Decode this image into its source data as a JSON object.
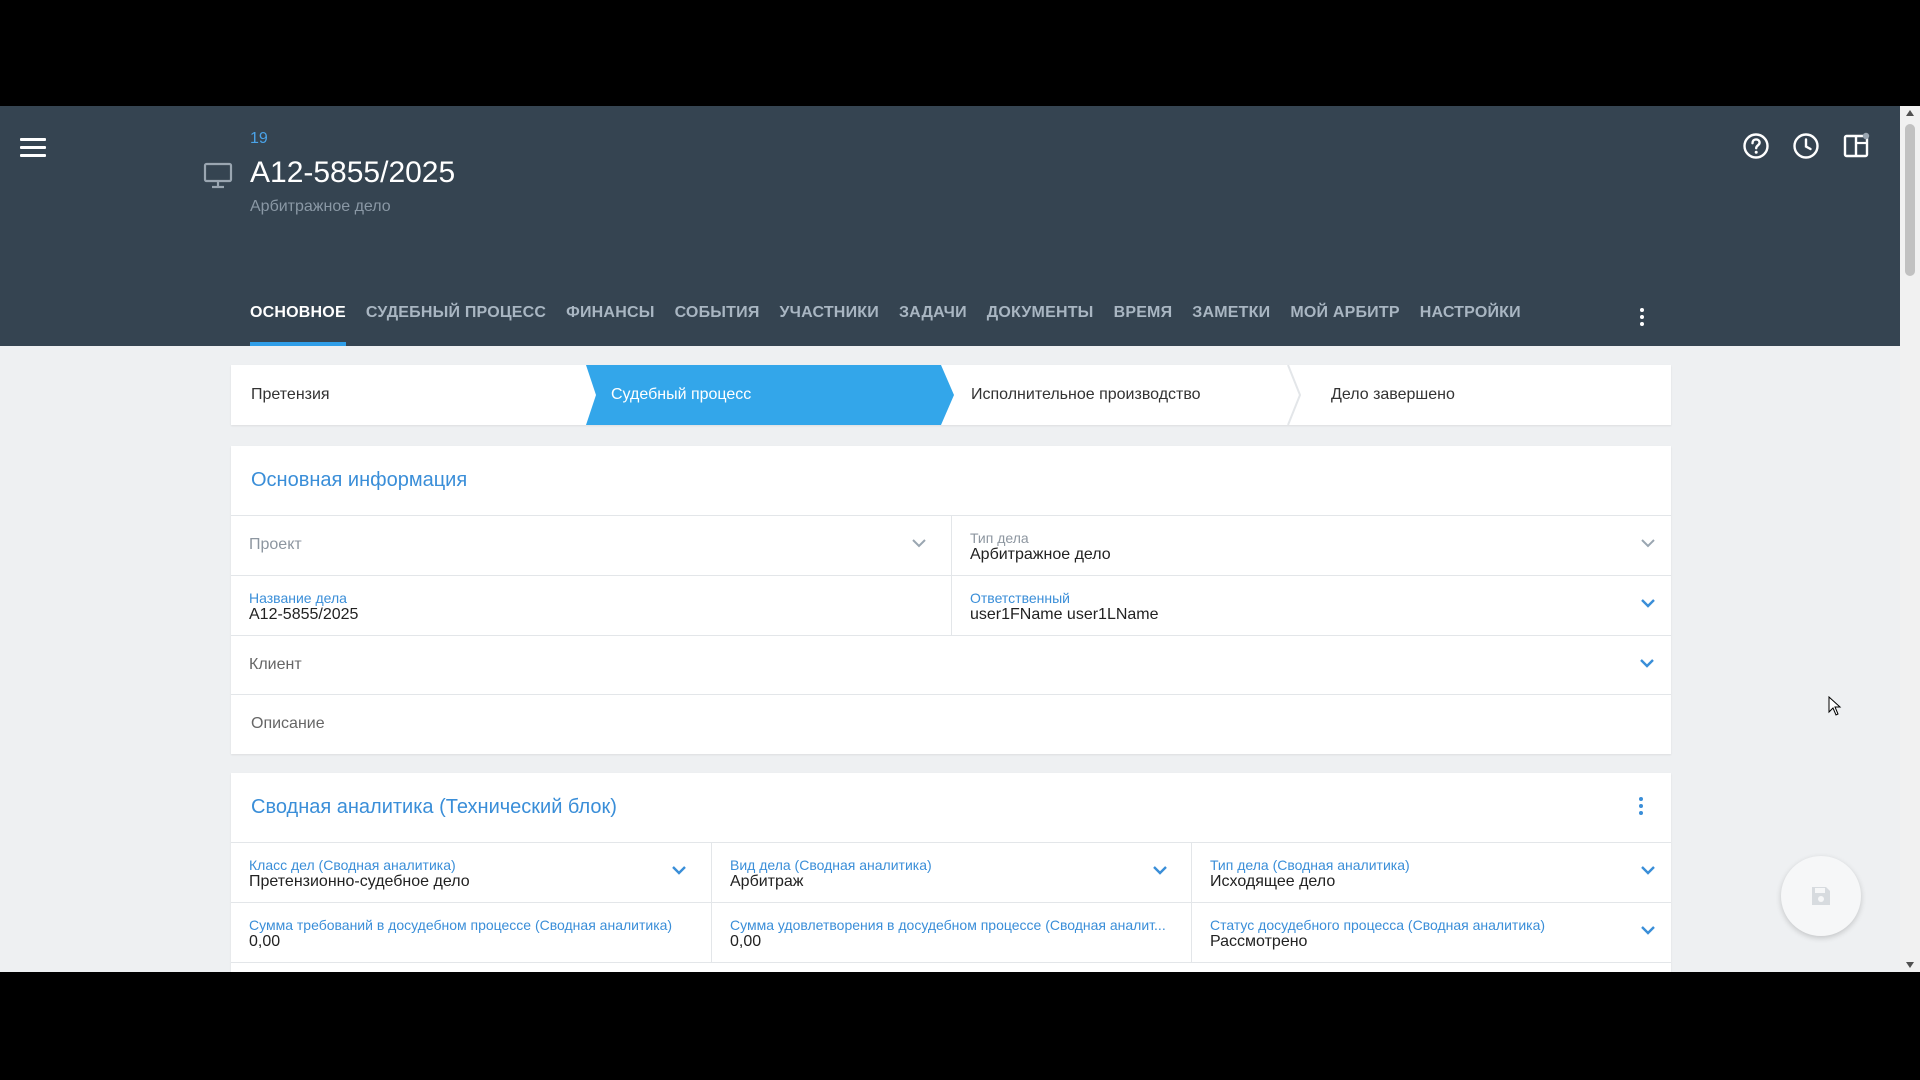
{
  "header": {
    "case_number": "19",
    "title": "А12-5855/2025",
    "subtitle": "Арбитражное дело",
    "icons": [
      "menu-icon",
      "monitor-icon",
      "help-icon",
      "history-clock-icon",
      "panel-layout-icon",
      "more-vertical-icon"
    ]
  },
  "tabs": [
    {
      "label": "ОСНОВНОЕ",
      "active": true
    },
    {
      "label": "СУДЕБНЫЙ ПРОЦЕСС"
    },
    {
      "label": "ФИНАНСЫ"
    },
    {
      "label": "СОБЫТИЯ"
    },
    {
      "label": "УЧАСТНИКИ"
    },
    {
      "label": "ЗАДАЧИ"
    },
    {
      "label": "ДОКУМЕНТЫ"
    },
    {
      "label": "ВРЕМЯ"
    },
    {
      "label": "ЗАМЕТКИ"
    },
    {
      "label": "МОЙ АРБИТР"
    },
    {
      "label": "НАСТРОЙКИ"
    }
  ],
  "stages": [
    {
      "label": "Претензия"
    },
    {
      "label": "Судебный процесс",
      "active": true
    },
    {
      "label": "Исполнительное производство"
    },
    {
      "label": "Дело завершено"
    }
  ],
  "main_info": {
    "title": "Основная информация",
    "project_placeholder": "Проект",
    "case_type": {
      "label": "Тип дела",
      "value": "Арбитражное дело"
    },
    "case_name": {
      "label": "Название дела",
      "value": "А12-5855/2025"
    },
    "responsible": {
      "label": "Ответственный",
      "value": "user1FName user1LName"
    },
    "client_placeholder": "Клиент",
    "description_placeholder": "Описание"
  },
  "analytics": {
    "title": "Сводная аналитика (Технический блок)",
    "fields": [
      {
        "label": "Класс дел (Сводная аналитика)",
        "value": "Претензионно-судебное дело"
      },
      {
        "label": "Вид дела (Сводная аналитика)",
        "value": "Арбитраж"
      },
      {
        "label": "Тип дела (Сводная аналитика)",
        "value": "Исходящее дело"
      },
      {
        "label": "Сумма требований в досудебном процессе (Сводная аналитика)",
        "value": "0,00"
      },
      {
        "label": "Сумма удовлетворения в досудебном процессе (Сводная аналит...",
        "value": "0,00"
      },
      {
        "label": "Статус досудебного процесса (Сводная аналитика)",
        "value": "Рассмотрено"
      }
    ]
  },
  "colors": {
    "header_bg": "#354451",
    "accent": "#3a8ed8",
    "active_stage": "#33a6ea",
    "page_bg": "#eef0f2"
  },
  "fab_icon": "save-icon"
}
